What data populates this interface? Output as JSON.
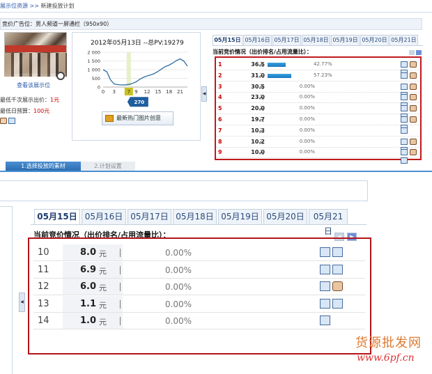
{
  "breadcrumb": {
    "parent": "展示位资源",
    "sep": ">>",
    "current": "新建投放计划"
  },
  "ad_position": "竞价广告位：男人频道一屏通栏（950x90）",
  "left_panel": {
    "see_position": "查看该展示位",
    "min_bid_label": "最低千次展示出价：",
    "min_bid_value": "1元",
    "daily_budget_label": "最低日预算：",
    "daily_budget_value": "100元"
  },
  "chart_panel": {
    "title": "2012年05月13日 --总PV:19279",
    "create_button": "最新热门图片创意"
  },
  "chart_data": {
    "type": "line",
    "x": [
      0,
      1,
      2,
      3,
      4,
      5,
      6,
      7,
      8,
      9,
      10,
      11,
      12,
      13,
      14,
      15,
      16,
      17,
      18,
      19,
      20,
      21,
      22,
      23
    ],
    "values": [
      1000,
      880,
      420,
      180,
      140,
      120,
      130,
      150,
      210,
      300,
      450,
      560,
      640,
      700,
      780,
      900,
      1050,
      1180,
      1260,
      1380,
      1520,
      1620,
      1500,
      1200
    ],
    "xticks": [
      "0",
      "3",
      "7",
      "9",
      "12",
      "15",
      "18",
      "21"
    ],
    "yticks": [
      "2 000",
      "1 500",
      "1 000",
      "500",
      "0"
    ],
    "ylim": [
      0,
      2000
    ],
    "highlight_x": "7",
    "highlight_value": "270",
    "grid": true
  },
  "date_tabs": [
    "05月15日",
    "05月16日",
    "05月17日",
    "05月18日",
    "05月19日",
    "05月20日",
    "05月21日"
  ],
  "status_title": "当前竞价情况（出价排名/占用流量比）：",
  "small_rows": [
    {
      "rank": "1",
      "price": "36.5",
      "unit": "元",
      "bar": 0.4277,
      "pct": "42.77%",
      "icons": [
        "b",
        "p",
        "b"
      ]
    },
    {
      "rank": "2",
      "price": "31.0",
      "unit": "元",
      "bar": 0.5723,
      "pct": "57.23%",
      "icons": [
        "b",
        "p"
      ]
    },
    {
      "rank": "3",
      "price": "30.5",
      "unit": "元",
      "bar": 0,
      "pct": "0.00%",
      "icons": [
        "b",
        "p",
        "b"
      ]
    },
    {
      "rank": "4",
      "price": "23.0",
      "unit": "元",
      "bar": 0,
      "pct": "0.00%",
      "icons": [
        "b",
        "p",
        "b"
      ]
    },
    {
      "rank": "5",
      "price": "20.0",
      "unit": "元",
      "bar": 0,
      "pct": "0.00%",
      "icons": [
        "b",
        "p",
        "b"
      ]
    },
    {
      "rank": "6",
      "price": "19.7",
      "unit": "元",
      "bar": 0,
      "pct": "0.00%",
      "icons": [
        "b",
        "p",
        "b"
      ]
    },
    {
      "rank": "7",
      "price": "10.3",
      "unit": "元",
      "bar": 0,
      "pct": "0.00%",
      "icons": [
        "b"
      ]
    },
    {
      "rank": "8",
      "price": "10.2",
      "unit": "元",
      "bar": 0,
      "pct": "0.00%",
      "icons": [
        "b",
        "p",
        "b"
      ]
    },
    {
      "rank": "9",
      "price": "10.0",
      "unit": "元",
      "bar": 0,
      "pct": "0.00%",
      "icons": [
        "b",
        "p",
        "b"
      ]
    }
  ],
  "steps": [
    "1.选择投放的素材",
    "2.计划设置"
  ],
  "big_rows": [
    {
      "rank": "10",
      "price": "8.0",
      "unit": "元",
      "pct": "0.00%",
      "icons": [
        "b",
        "b"
      ]
    },
    {
      "rank": "11",
      "price": "6.9",
      "unit": "元",
      "pct": "0.00%",
      "icons": [
        "b",
        "b"
      ]
    },
    {
      "rank": "12",
      "price": "6.0",
      "unit": "元",
      "pct": "0.00%",
      "icons": [
        "b",
        "p"
      ]
    },
    {
      "rank": "13",
      "price": "1.1",
      "unit": "元",
      "pct": "0.00%",
      "icons": [
        "b",
        "b"
      ]
    },
    {
      "rank": "14",
      "price": "1.0",
      "unit": "元",
      "pct": "0.00%",
      "icons": [
        "b"
      ]
    }
  ],
  "watermark": {
    "cn": "货源批发网",
    "url": "www.6pf.cn"
  }
}
